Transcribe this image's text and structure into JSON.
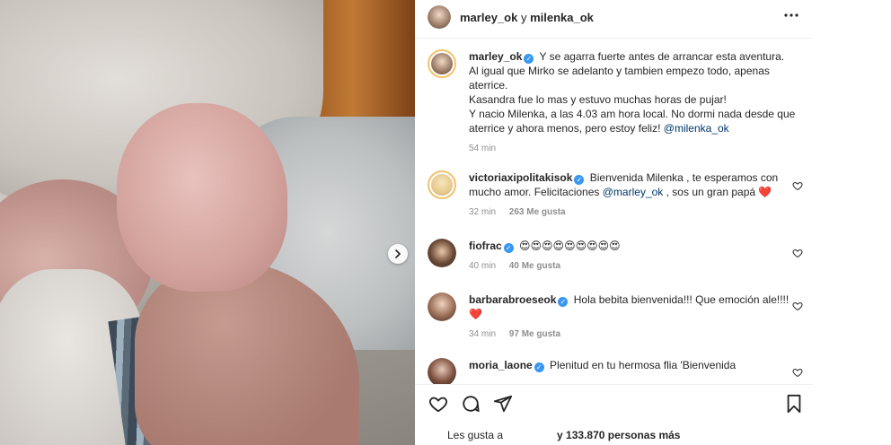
{
  "photo": {
    "next_icon": "chevron-right-icon"
  },
  "header": {
    "user_a": "marley_ok",
    "connector": "y",
    "user_b": "milenka_ok",
    "more_icon": "more-horizontal-icon"
  },
  "caption": {
    "user": "marley_ok",
    "text_1": "Y se agarra fuerte antes de arrancar esta aventura.",
    "text_2": "Al igual que Mirko se adelanto y tambien empezo todo, apenas aterrice.",
    "text_3": "Kasandra fue lo mas y estuvo muchas horas de pujar!",
    "text_4": "Y nacio Milenka, a las 4.03 am hora local. No dormi nada desde que aterrice y ahora menos, pero estoy feliz!",
    "mention": "@milenka_ok",
    "time": "54 min"
  },
  "comments": [
    {
      "user": "victoriaxipolitakisok",
      "text": "Bienvenida Milenka , te esperamos con mucho amor. Felicitaciones",
      "mention": "@marley_ok",
      "text_after": ", sos un gran papá",
      "emoji": "❤️",
      "time": "32 min",
      "likes": "263 Me gusta"
    },
    {
      "user": "fiofrac",
      "text": "",
      "emoji": "😍😍😍😍😍😍😍😍😍",
      "time": "40 min",
      "likes": "40 Me gusta"
    },
    {
      "user": "barbarabroeseok",
      "text": "Hola bebita bienvenida!!! Que emoción ale!!!!",
      "emoji": "❤️",
      "time": "34 min",
      "likes": "97 Me gusta"
    },
    {
      "user": "moria_laone",
      "text": "Plenitud en tu hermosa flia 'Bienvenida"
    }
  ],
  "actions": {
    "like_icon": "heart-icon",
    "comment_icon": "comment-icon",
    "share_icon": "send-icon",
    "save_icon": "bookmark-icon"
  },
  "likes_line": {
    "prefix": "Les gusta a",
    "count_text": "y 133.870 personas más"
  },
  "colors": {
    "verified": "#3897f0",
    "heart_red": "#ed4956",
    "muted": "#8e8e8e",
    "mention": "#00376b"
  }
}
